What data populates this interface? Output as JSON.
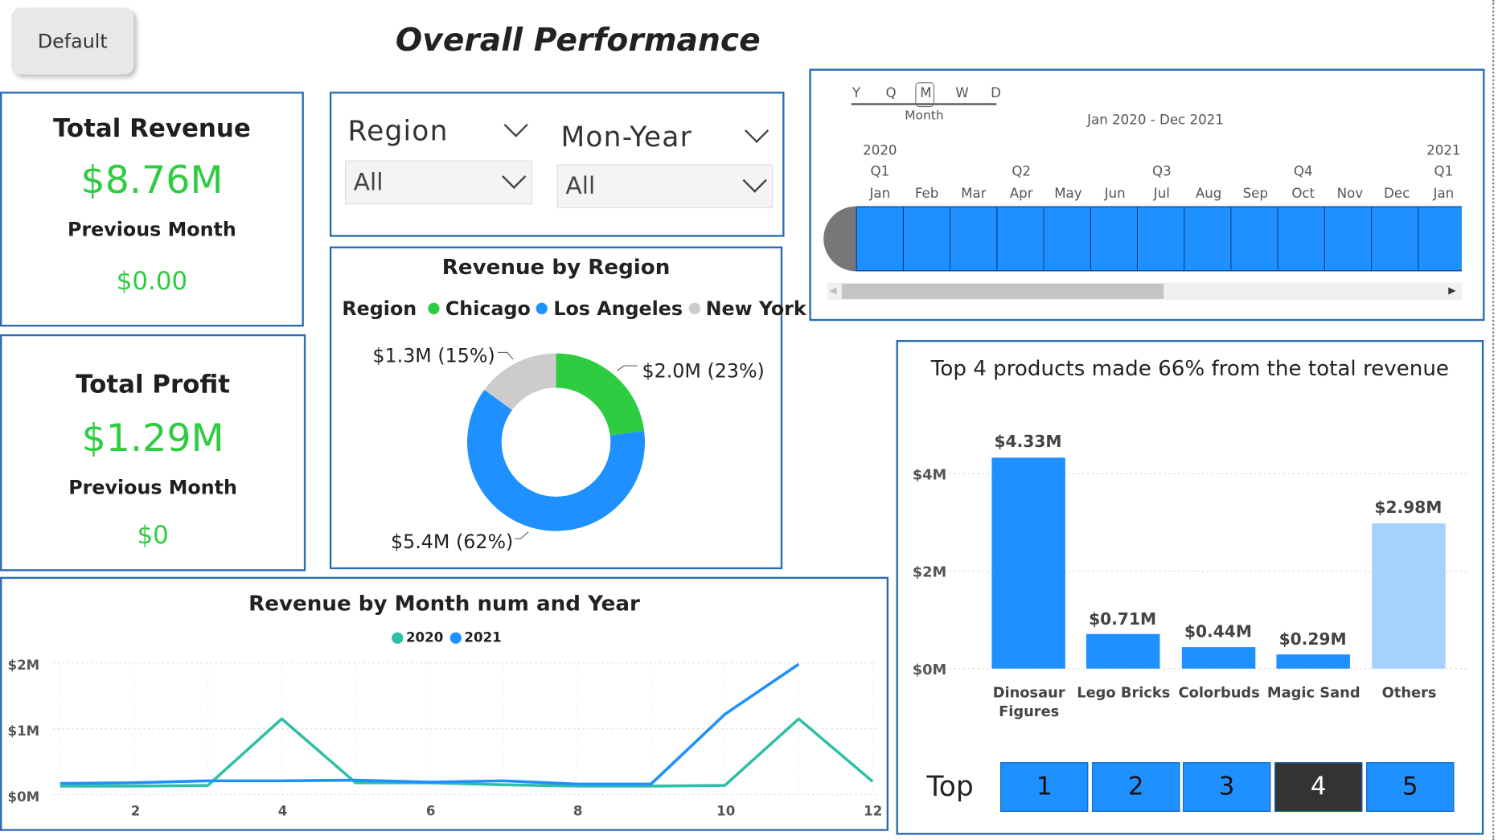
{
  "default_button": "Default",
  "title": "Overall Performance",
  "kpi_revenue": {
    "title": "Total Revenue",
    "value": "$8.76M",
    "sub": "Previous Month",
    "prev": "$0.00"
  },
  "kpi_profit": {
    "title": "Total Profit",
    "value": "$1.29M",
    "sub": "Previous Month",
    "prev": "$0"
  },
  "slicers": {
    "region": {
      "label": "Region",
      "value": "All"
    },
    "monyear": {
      "label": "Mon-Year",
      "value": "All"
    }
  },
  "timeline": {
    "granularity": [
      "Y",
      "Q",
      "M",
      "W",
      "D"
    ],
    "selected_granularity": "M",
    "granularity_label": "Month",
    "range_label": "Jan 2020 - Dec 2021",
    "years": [
      "2020",
      "2021"
    ],
    "quarters": [
      "Q1",
      "Q2",
      "Q3",
      "Q4",
      "Q1"
    ],
    "months": [
      "Jan",
      "Feb",
      "Mar",
      "Apr",
      "May",
      "Jun",
      "Jul",
      "Aug",
      "Sep",
      "Oct",
      "Nov",
      "Dec",
      "Jan"
    ],
    "fill_color": "#1e90ff"
  },
  "donut": {
    "title": "Revenue by Region",
    "legend_title": "Region",
    "labels": {
      "chicago": "$2.0M (23%)",
      "newyork": "$1.3M (15%)",
      "losangeles": "$5.4M (62%)"
    }
  },
  "line": {
    "title": "Revenue by Month num and Year",
    "y_ticks": [
      "$2M",
      "$1M",
      "$0M"
    ],
    "x_ticks": [
      "2",
      "4",
      "6",
      "8",
      "10",
      "12"
    ]
  },
  "bar": {
    "title": "Top 4 products made 66% from the total revenue",
    "y_ticks": [
      "$4M",
      "$2M",
      "$0M"
    ],
    "value_labels": [
      "$4.33M",
      "$0.71M",
      "$0.44M",
      "$0.29M",
      "$2.98M"
    ],
    "categories": [
      [
        "Dinosaur",
        "Figures"
      ],
      [
        "Lego Bricks"
      ],
      [
        "Colorbuds"
      ],
      [
        "Magic Sand"
      ],
      [
        "Others"
      ]
    ]
  },
  "topn": {
    "label": "Top",
    "options": [
      "1",
      "2",
      "3",
      "4",
      "5"
    ],
    "selected": "4"
  },
  "chart_data": [
    {
      "type": "pie",
      "title": "Revenue by Region",
      "legend": "top",
      "categories": [
        "Chicago",
        "Los Angeles",
        "New York"
      ],
      "values": [
        2.0,
        5.4,
        1.3
      ],
      "colors": [
        "#2ecc40",
        "#1e90ff",
        "#cccccc"
      ]
    },
    {
      "type": "line",
      "title": "Revenue by Month num and Year",
      "x": [
        1,
        2,
        3,
        4,
        5,
        6,
        7,
        8,
        9,
        10,
        11,
        12
      ],
      "ylim": [
        0,
        2
      ],
      "legend": "top",
      "series": [
        {
          "name": "2020",
          "color": "#2ebfa5",
          "values": [
            0.13,
            0.13,
            0.14,
            1.15,
            0.18,
            0.18,
            0.15,
            0.13,
            0.13,
            0.14,
            1.15,
            0.2
          ]
        },
        {
          "name": "2021",
          "color": "#1e90ff",
          "values": [
            0.17,
            0.18,
            0.21,
            0.21,
            0.22,
            0.19,
            0.21,
            0.16,
            0.16,
            1.22,
            1.98,
            null
          ]
        }
      ]
    },
    {
      "type": "bar",
      "title": "Top 4 products made 66% from the total revenue",
      "categories": [
        "Dinosaur Figures",
        "Lego Bricks",
        "Colorbuds",
        "Magic Sand",
        "Others"
      ],
      "values": [
        4.33,
        0.71,
        0.44,
        0.29,
        2.98
      ],
      "ylim": [
        0,
        4.8
      ],
      "colors": [
        "#1e90ff",
        "#1e90ff",
        "#1e90ff",
        "#1e90ff",
        "#a6d1ff"
      ]
    }
  ]
}
